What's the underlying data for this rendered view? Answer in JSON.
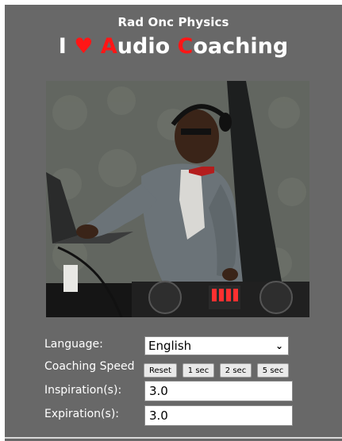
{
  "header": {
    "subtitle": "Rad Onc Physics",
    "title_lead": "I",
    "heart": "♥",
    "title_a": "A",
    "title_udio": "udio",
    "title_c": "C",
    "title_oaching": "oaching"
  },
  "photo": {
    "icon": "dj-photo"
  },
  "form": {
    "language_label": "Language:",
    "language_value": "English",
    "speed_label": "Coaching Speed",
    "speed_buttons": [
      "Reset",
      "1 sec",
      "2 sec",
      "5 sec"
    ],
    "inspiration_label": "Inspiration(s):",
    "inspiration_value": "3.0",
    "expiration_label": "Expiration(s):",
    "expiration_value": "3.0"
  },
  "colors": {
    "panel": "#686868",
    "accent_red": "#ff1616"
  }
}
